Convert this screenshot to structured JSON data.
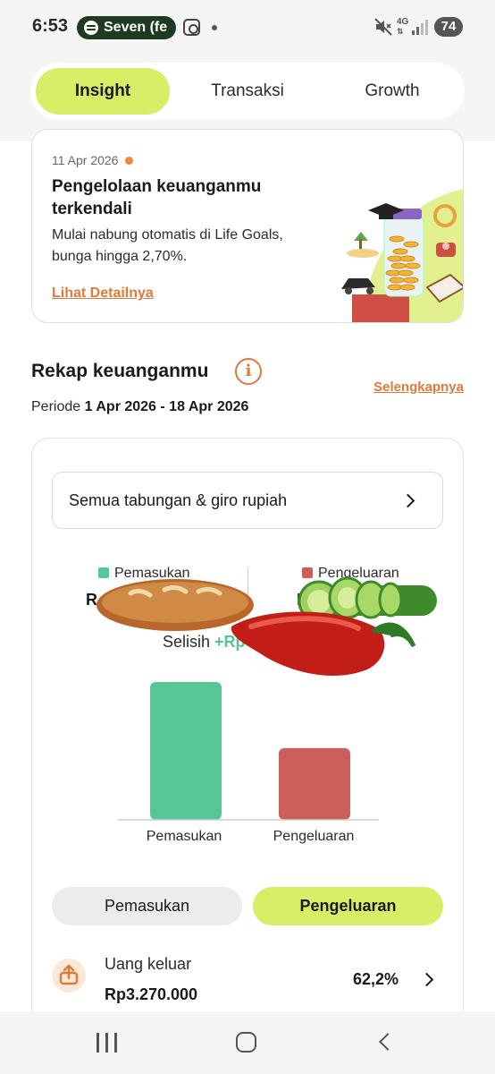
{
  "status_bar": {
    "time": "6:53",
    "media_pill": "Seven (fe",
    "network": "4G",
    "battery": "74"
  },
  "tabs": [
    {
      "label": "Insight",
      "active": true
    },
    {
      "label": "Transaksi",
      "active": false
    },
    {
      "label": "Growth",
      "active": false
    }
  ],
  "promo": {
    "date": "11 Apr 2026",
    "title": "Pengelolaan keuanganmu terkendali",
    "description": "Mulai nabung otomatis di Life Goals, bunga hingga 2,70%.",
    "link": "Lihat Detailnya"
  },
  "recap": {
    "title": "Rekap keuanganmu",
    "see_more": "Selengkapnya",
    "period_prefix": "Periode",
    "period_range": "1 Apr 2026 - 18 Apr 2026",
    "account_selector": "Semua tabungan & giro rupiah",
    "legend_income": "Pemasukan",
    "legend_expense": "Pengeluaran",
    "income_amount_fragment": "R",
    "expense_amount_fragment": "I",
    "difference_label": "Selisih",
    "difference_value_fragment": "+Rp"
  },
  "colors": {
    "accent": "#d9ee67",
    "income": "#58c797",
    "expense": "#cd5f5b",
    "link": "#e07a3a"
  },
  "chart_data": {
    "type": "bar",
    "categories": [
      "Pemasukan",
      "Pengeluaran"
    ],
    "values": [
      100,
      52
    ],
    "ylim": [
      0,
      100
    ],
    "grid": false
  },
  "toggle": {
    "income_label": "Pemasukan",
    "expense_label": "Pengeluaran",
    "selected": "Pengeluaran"
  },
  "outflow": {
    "label": "Uang keluar",
    "amount": "Rp3.270.000",
    "percent": "62,2%"
  },
  "icons": {
    "info": "i",
    "nav": [
      "recent-apps-icon",
      "home-icon",
      "back-icon"
    ]
  }
}
